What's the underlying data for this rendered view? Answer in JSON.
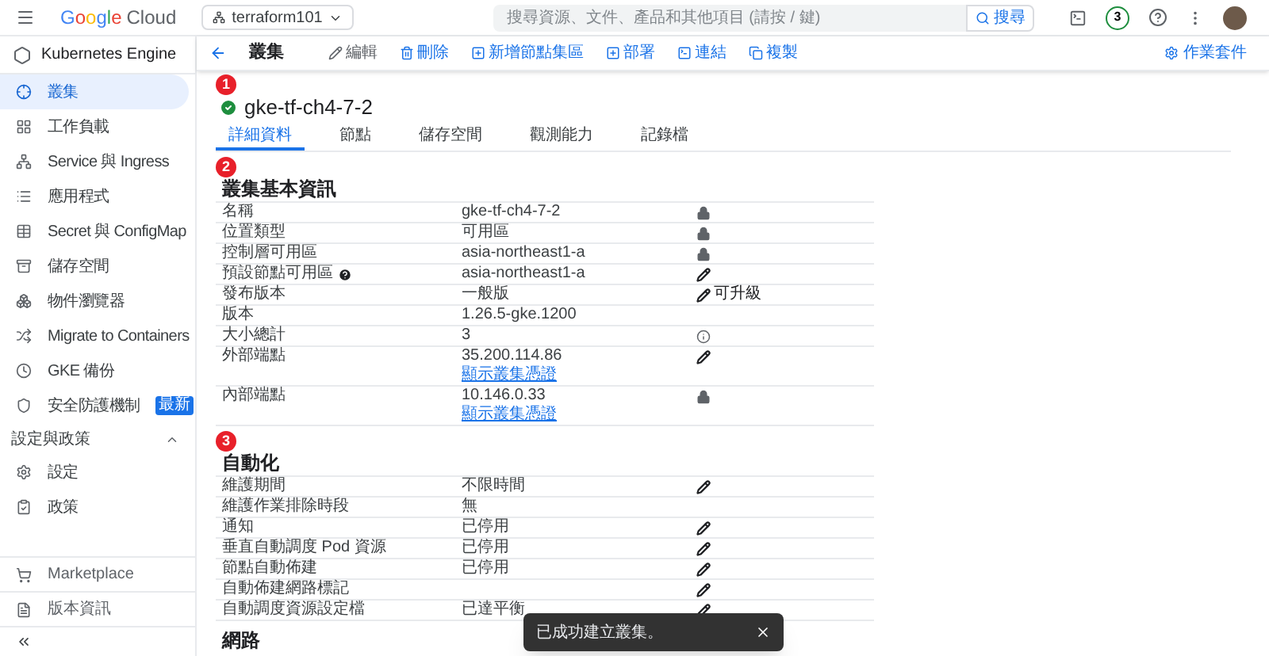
{
  "header": {
    "brand": "Google",
    "product": "Cloud",
    "project": "terraform101",
    "search_placeholder": "搜尋資源、文件、產品和其他項目 (請按 / 鍵)",
    "search_button": "搜尋",
    "notifications": "3"
  },
  "sidebar": {
    "title": "Kubernetes Engine",
    "items": [
      {
        "label": "叢集",
        "selected": true
      },
      {
        "label": "工作負載",
        "selected": false
      },
      {
        "label": "Service 與 Ingress",
        "selected": false
      },
      {
        "label": "應用程式",
        "selected": false
      },
      {
        "label": "Secret 與 ConfigMap",
        "selected": false
      },
      {
        "label": "儲存空間",
        "selected": false
      },
      {
        "label": "物件瀏覽器",
        "selected": false
      },
      {
        "label": "Migrate to Containers",
        "selected": false
      },
      {
        "label": "GKE 備份",
        "selected": false
      },
      {
        "label": "安全防護機制",
        "selected": false,
        "badge": "最新"
      }
    ],
    "group": {
      "title": "設定與政策",
      "expanded": true,
      "items": [
        {
          "label": "設定",
          "selected": false
        },
        {
          "label": "政策",
          "selected": false
        }
      ]
    },
    "footer": [
      {
        "label": "Marketplace"
      },
      {
        "label": "版本資訊"
      }
    ]
  },
  "toolbar": {
    "title": "叢集",
    "actions": [
      {
        "label": "編輯",
        "disabled": true
      },
      {
        "label": "刪除",
        "disabled": false
      },
      {
        "label": "新增節點集區",
        "disabled": false
      },
      {
        "label": "部署",
        "disabled": false
      },
      {
        "label": "連結",
        "disabled": false
      },
      {
        "label": "複製",
        "disabled": false
      }
    ],
    "right_action": "作業套件"
  },
  "cluster": {
    "name": "gke-tf-ch4-7-2",
    "marker": "1"
  },
  "tabs": [
    {
      "label": "詳細資料",
      "selected": true
    },
    {
      "label": "節點",
      "selected": false
    },
    {
      "label": "儲存空間",
      "selected": false
    },
    {
      "label": "觀測能力",
      "selected": false
    },
    {
      "label": "記錄檔",
      "selected": false
    }
  ],
  "sections": [
    {
      "title": "叢集基本資訊",
      "marker": "2",
      "rows": [
        {
          "label": "名稱",
          "value": "gke-tf-ch4-7-2",
          "kind": "locked"
        },
        {
          "label": "位置類型",
          "value": "可用區",
          "kind": "locked"
        },
        {
          "label": "控制層可用區",
          "value": "asia-northeast1-a",
          "kind": "locked"
        },
        {
          "label": "預設節點可用區",
          "help": true,
          "value": "asia-northeast1-a",
          "kind": "editable"
        },
        {
          "label": "發布版本",
          "value": "一般版",
          "kind": "editable",
          "action_text": "可升級"
        },
        {
          "label": "版本",
          "value": "1.26.5-gke.1200",
          "kind": "plain"
        },
        {
          "label": "大小總計",
          "value": "3",
          "kind": "info"
        },
        {
          "label": "外部端點",
          "value": "35.200.114.86",
          "link": "顯示叢集憑證",
          "kind": "editable"
        },
        {
          "label": "內部端點",
          "value": "10.146.0.33",
          "link": "顯示叢集憑證",
          "kind": "locked"
        }
      ]
    },
    {
      "title": "自動化",
      "marker": "3",
      "rows": [
        {
          "label": "維護期間",
          "value": "不限時間",
          "kind": "editable"
        },
        {
          "label": "維護作業排除時段",
          "value": "無",
          "kind": "plain"
        },
        {
          "label": "通知",
          "value": "已停用",
          "kind": "editable"
        },
        {
          "label": "垂直自動調度 Pod 資源",
          "value": "已停用",
          "kind": "editable"
        },
        {
          "label": "節點自動佈建",
          "value": "已停用",
          "kind": "editable"
        },
        {
          "label": "自動佈建網路標記",
          "kind": "editable"
        },
        {
          "label": "自動調度資源設定檔",
          "value": "已達平衡",
          "kind": "editable"
        }
      ]
    },
    {
      "title": "網路"
    }
  ],
  "toast": {
    "message": "已成功建立叢集。"
  }
}
